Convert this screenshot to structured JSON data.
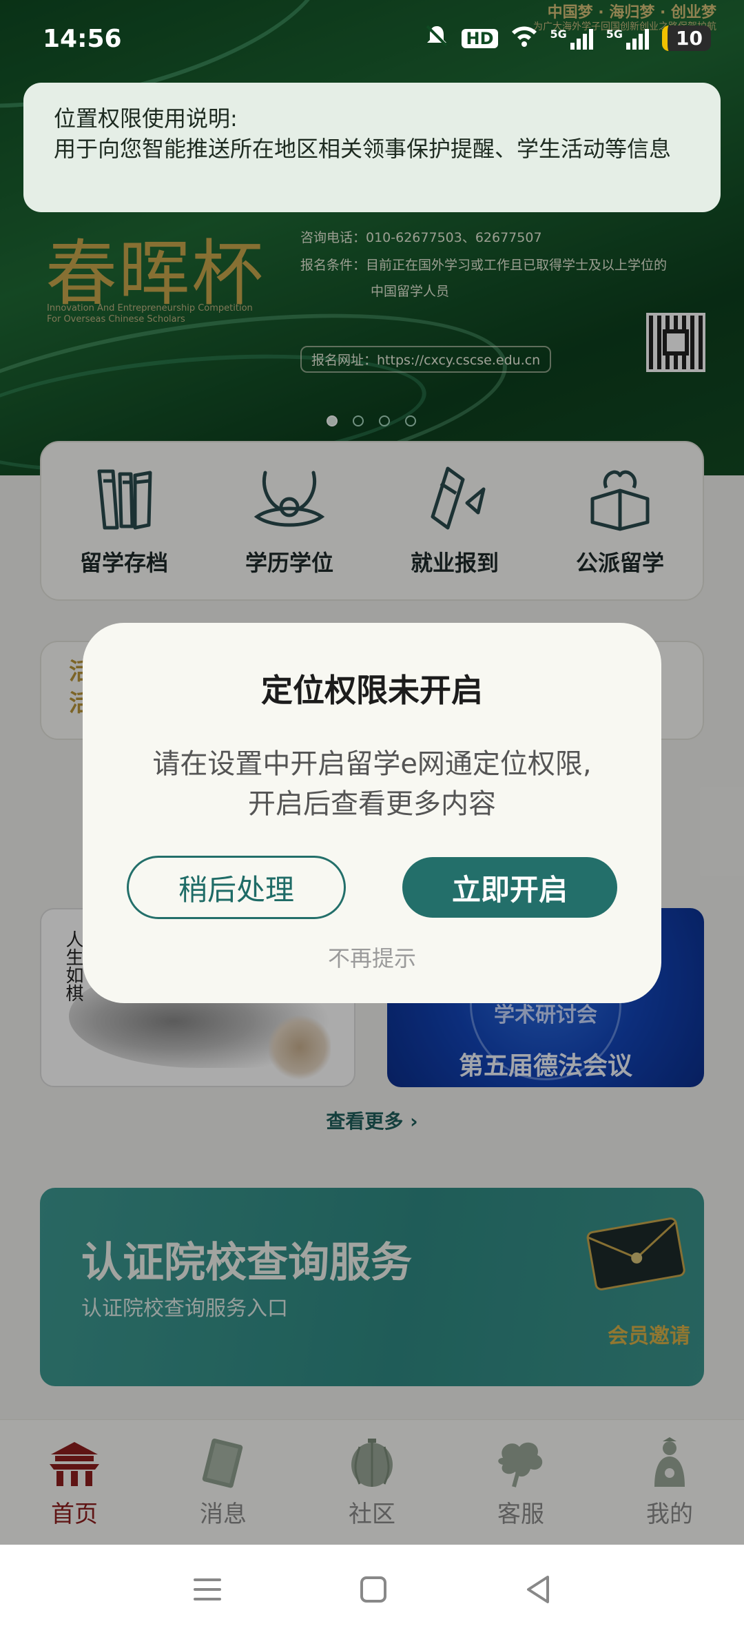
{
  "status_bar": {
    "time": "14:56",
    "hd": "HD",
    "net1": "5G",
    "net2": "5G",
    "battery": "10"
  },
  "toast": {
    "title": "位置权限使用说明:",
    "message": "用于向您智能推送所在地区相关领事保护提醒、学生活动等信息"
  },
  "banner": {
    "slogan": "中国梦 · 海归梦 · 创业梦",
    "slogan_sub": "为广大海外学子回国创新创业之路保驾护航",
    "title": "春晖杯",
    "en_title": "Innovation And Entrepreneurship Competition For Overseas Chinese Scholars",
    "phone": "咨询电话：010-62677503、62677507",
    "condition": "报名条件：目前正在国外学习或工作且已取得学士及以上学位的",
    "condition_2": "中国留学人员",
    "url": "报名网址：https://cxcy.cscse.edu.cn",
    "active_slide": 1,
    "slide_count": 4
  },
  "quick_links": [
    {
      "label": "留学存档",
      "icon": "archive-icon"
    },
    {
      "label": "学历学位",
      "icon": "degree-icon"
    },
    {
      "label": "就业报到",
      "icon": "employment-icon"
    },
    {
      "label": "公派留学",
      "icon": "scholarship-icon"
    }
  ],
  "notice": {
    "line1": "活",
    "line2": "活"
  },
  "news": {
    "left_title": "人生如棋",
    "right_sub": "学术研讨会",
    "right_main": "第五届德法会议"
  },
  "see_more": "查看更多",
  "cert": {
    "title": "认证院校查询服务",
    "subtitle": "认证院校查询服务入口",
    "invite": "会员邀请"
  },
  "tabs": [
    {
      "label": "首页",
      "icon": "home-icon",
      "active": true
    },
    {
      "label": "消息",
      "icon": "message-icon",
      "active": false
    },
    {
      "label": "社区",
      "icon": "community-icon",
      "active": false
    },
    {
      "label": "客服",
      "icon": "service-icon",
      "active": false
    },
    {
      "label": "我的",
      "icon": "profile-icon",
      "active": false
    }
  ],
  "dialog": {
    "title": "定位权限未开启",
    "message": "请在设置中开启留学e网通定位权限, 开启后查看更多内容",
    "later": "稍后处理",
    "open": "立即开启",
    "never": "不再提示"
  },
  "colors": {
    "accent": "#236f6a",
    "tab_active": "#8e1e1e",
    "gold": "#c9a84c"
  }
}
